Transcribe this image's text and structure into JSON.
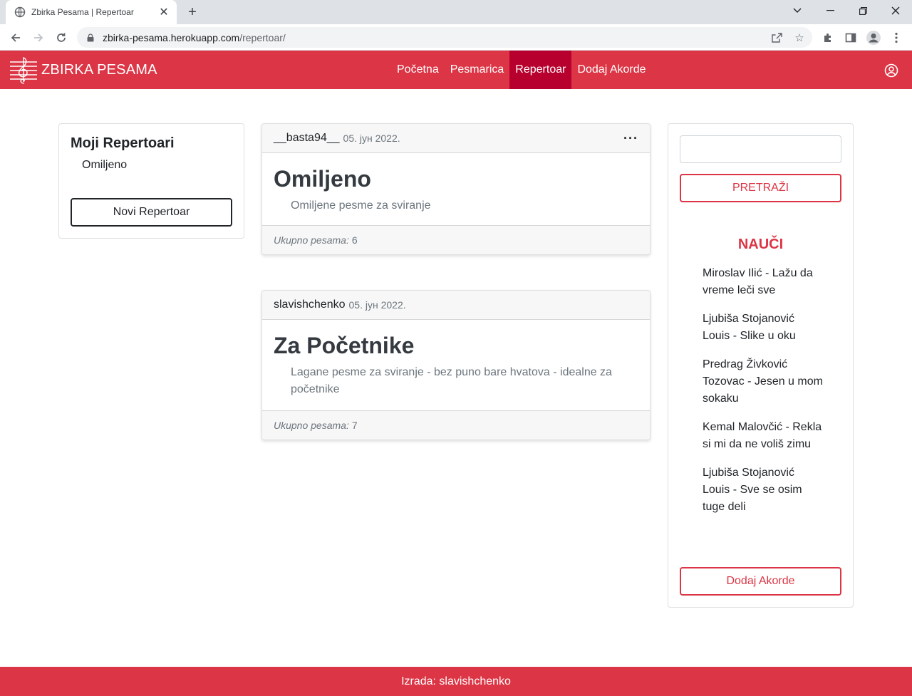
{
  "browser": {
    "tab_title": "Zbirka Pesama | Repertoar",
    "url_host": "zbirka-pesama.herokuapp.com",
    "url_path": "/repertoar/"
  },
  "navbar": {
    "brand": "ZBIRKA PESAMA",
    "links": [
      "Početna",
      "Pesmarica",
      "Repertoar",
      "Dodaj Akorde"
    ],
    "active": "Repertoar",
    "accent_color": "#dc3545",
    "active_color": "#b8002e"
  },
  "sidebar": {
    "title": "Moji Repertoari",
    "items": [
      "Omiljeno"
    ],
    "new_button": "Novi Repertoar"
  },
  "posts": [
    {
      "author": "__basta94__",
      "date": "05. јун 2022.",
      "title": "Omiljeno",
      "description": "Omiljene pesme za sviranje",
      "count_label": "Ukupno pesama:",
      "count": "6",
      "menu_icon": "more-icon"
    },
    {
      "author": "slavishchenko",
      "date": "05. јун 2022.",
      "title": "Za Početnike",
      "description": "Lagane pesme za sviranje - bez puno bare hvatova - idealne za početnike",
      "count_label": "Ukupno pesama:",
      "count": "7"
    }
  ],
  "right": {
    "search_button": "PRETRAŽI",
    "learn_title": "NAUČI",
    "learn_items": [
      "Miroslav Ilić - Lažu da vreme leči sve",
      "Ljubiša Stojanović Louis - Slike u oku",
      "Predrag Živković Tozovac - Jesen u mom sokaku",
      "Kemal Malovčić - Rekla si mi da ne voliš zimu",
      "Ljubiša Stojanović Louis - Sve se osim tuge deli"
    ],
    "add_button": "Dodaj Akorde"
  },
  "footer": {
    "text": "Izrada: slavishchenko"
  }
}
